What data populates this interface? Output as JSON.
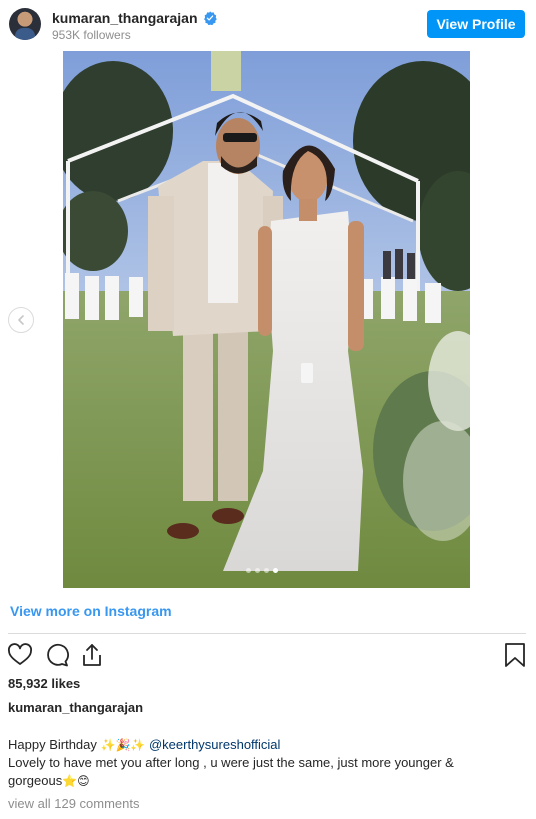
{
  "header": {
    "username": "kumaran_thangarajan",
    "followers": "953K followers",
    "view_profile_label": "View Profile"
  },
  "media": {
    "carousel_total": 4,
    "carousel_active": 4
  },
  "links": {
    "view_more": "View more on Instagram"
  },
  "stats": {
    "likes": "85,932 likes"
  },
  "caption": {
    "username": "kumaran_thangarajan",
    "line1_text": "Happy Birthday",
    "line1_emoji": "✨🎉✨",
    "mention": "@keerthysureshofficial",
    "line2": "Lovely to have met you after long , u were just the same, just more younger &",
    "line3_text": "gorgeous",
    "line3_emoji": "⭐😊"
  },
  "comments": {
    "view_all": "view all 129 comments"
  },
  "icons": {
    "like": "heart-icon",
    "comment": "comment-icon",
    "share": "share-icon",
    "save": "bookmark-icon",
    "verified": "verified-badge-icon",
    "prev": "chevron-left-icon"
  },
  "colors": {
    "accent": "#0095f6",
    "link": "#3897f0",
    "mention": "#00376b",
    "muted": "#8e8e8e"
  }
}
